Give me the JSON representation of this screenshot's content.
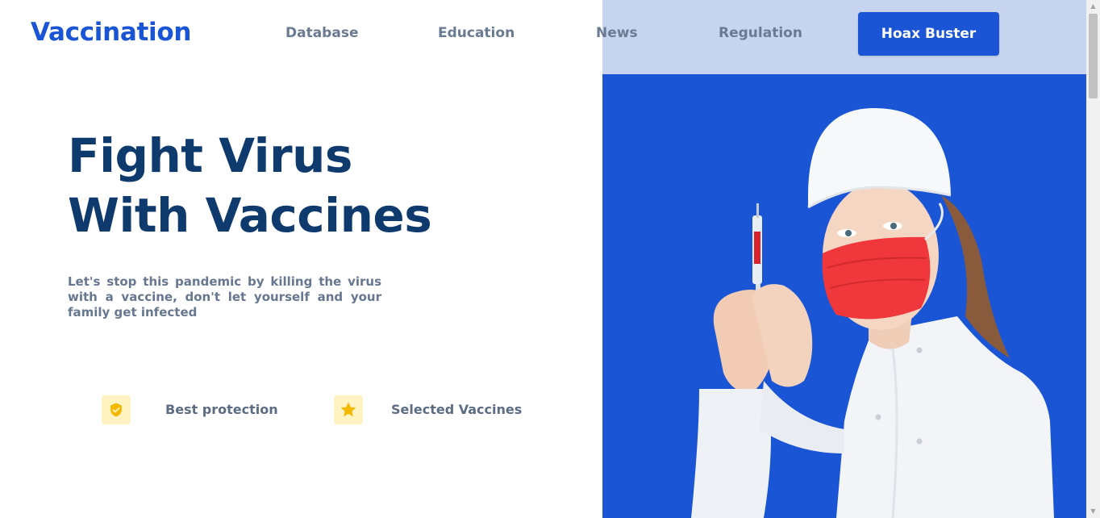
{
  "brand": {
    "logo": "Vaccination"
  },
  "nav": {
    "links": [
      "Database",
      "Education",
      "News",
      "Regulation"
    ],
    "cta": "Hoax Buster"
  },
  "hero": {
    "headline_line1": "Fight Virus",
    "headline_line2": "With Vaccines",
    "subtext": "Let's stop this pandemic by killing the virus with a vaccine, don't let yourself and your family get infected",
    "image_icon": "nurse-with-syringe-photo"
  },
  "features": [
    {
      "label": "Best protection",
      "icon": "shield-check-icon"
    },
    {
      "label": "Selected Vaccines",
      "icon": "star-icon"
    }
  ],
  "colors": {
    "brand": "#1a55d6",
    "headline": "#0f3a6e",
    "nav_text": "#6a7a90",
    "hero_band": "#c7d4f0",
    "feature_icon_bg": "#fff3c2",
    "feature_icon": "#f5b800",
    "mask": "#f0373b"
  }
}
